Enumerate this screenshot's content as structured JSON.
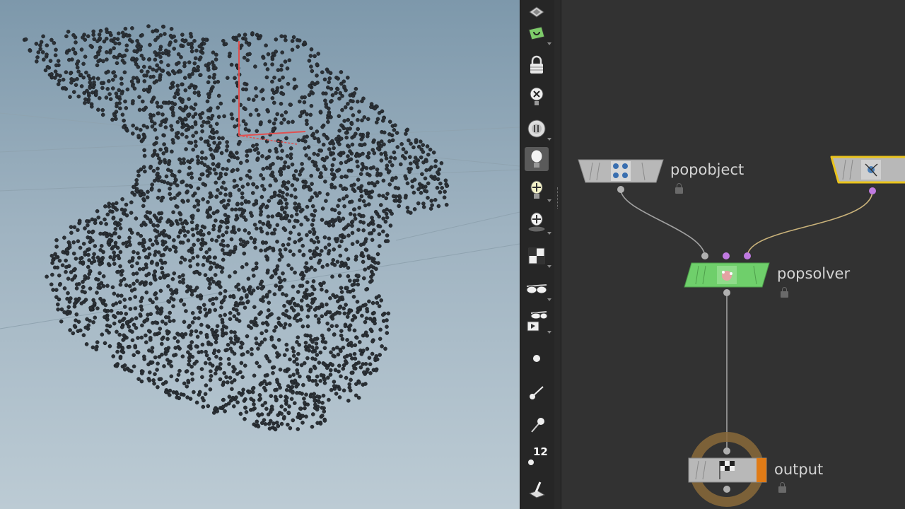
{
  "viewport": {
    "background_top": "#7d98ab",
    "background_bottom": "#bccbd4",
    "point_color": "#2b3035",
    "handle_color": "#e05050"
  },
  "toolbar": {
    "tools": [
      {
        "icon": "display-options-icon"
      },
      {
        "icon": "camera-view-icon"
      },
      {
        "icon": "lock-camera-icon"
      },
      {
        "icon": "close-circle-icon"
      },
      {
        "icon": "viewport-dial-icon"
      },
      {
        "icon": "lightbulb-icon",
        "selected": true
      },
      {
        "icon": "headlight-icon"
      },
      {
        "icon": "spotlight-icon"
      },
      {
        "icon": "checkered-cube-icon"
      },
      {
        "icon": "glasses-icon"
      },
      {
        "icon": "stereo-camera-icon"
      },
      {
        "icon": "point-display-icon"
      },
      {
        "icon": "normal-display-icon"
      },
      {
        "icon": "point-normal-icon"
      },
      {
        "icon": "point-number-icon",
        "label": "12"
      },
      {
        "icon": "brush-tool-icon"
      }
    ]
  },
  "network": {
    "nodes": [
      {
        "name": "popobject",
        "color": "#b8b8b8"
      },
      {
        "name": "",
        "color": "#b8b8b8",
        "highlight": "#e9c31c"
      },
      {
        "name": "popsolver",
        "color": "#6fcf6b"
      },
      {
        "name": "output",
        "color": "#b8b8b8",
        "flag": "#e07b16"
      }
    ],
    "wire_color": "#a0a0a0",
    "selected_wire_color": "#c9b27a"
  }
}
